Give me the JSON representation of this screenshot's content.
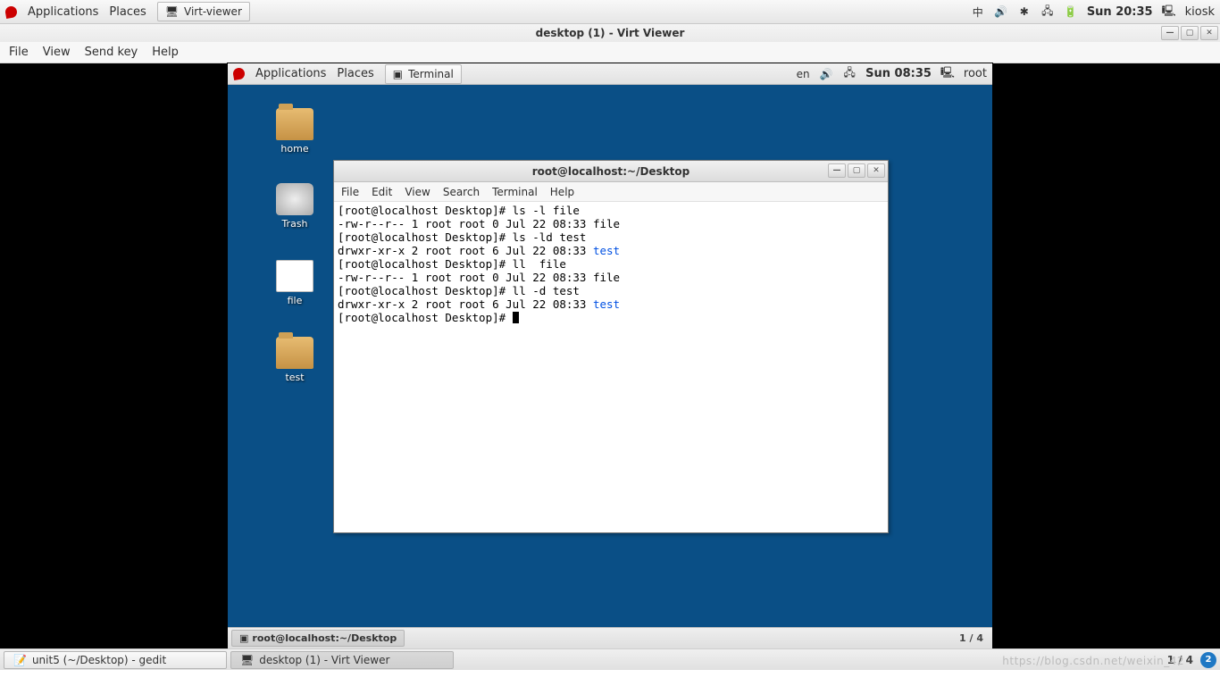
{
  "host": {
    "apps": "Applications",
    "places": "Places",
    "active_app": "Virt-viewer",
    "ime": "中",
    "time": "Sun 20:35",
    "user": "kiosk"
  },
  "vv": {
    "title": "desktop (1) - Virt Viewer",
    "menus": {
      "file": "File",
      "view": "View",
      "sendkey": "Send key",
      "help": "Help"
    }
  },
  "guest": {
    "topbar": {
      "apps": "Applications",
      "places": "Places",
      "active_app": "Terminal",
      "lang": "en",
      "time": "Sun 08:35",
      "user": "root"
    },
    "icons": {
      "home": "home",
      "trash": "Trash",
      "file": "file",
      "test": "test"
    },
    "taskbar": {
      "active": "root@localhost:~/Desktop",
      "pager": "1 / 4"
    }
  },
  "terminal": {
    "title": "root@localhost:~/Desktop",
    "menus": {
      "file": "File",
      "edit": "Edit",
      "view": "View",
      "search": "Search",
      "terminal": "Terminal",
      "help": "Help"
    },
    "lines": [
      {
        "prompt": "[root@localhost Desktop]# ",
        "cmd": "ls -l file"
      },
      {
        "out": "-rw-r--r-- 1 root root 0 Jul 22 08:33 file"
      },
      {
        "prompt": "[root@localhost Desktop]# ",
        "cmd": "ls -ld test"
      },
      {
        "out": "drwxr-xr-x 2 root root 6 Jul 22 08:33 ",
        "link": "test"
      },
      {
        "prompt": "[root@localhost Desktop]# ",
        "cmd": "ll  file"
      },
      {
        "out": "-rw-r--r-- 1 root root 0 Jul 22 08:33 file"
      },
      {
        "prompt": "[root@localhost Desktop]# ",
        "cmd": "ll -d test"
      },
      {
        "out": "drwxr-xr-x 2 root root 6 Jul 22 08:33 ",
        "link": "test"
      },
      {
        "prompt": "[root@localhost Desktop]# ",
        "cursor": true
      }
    ]
  },
  "host_taskbar": {
    "gedit": "unit5 (~/Desktop) - gedit",
    "vv": "desktop (1) - Virt Viewer",
    "pager": "1 / 4",
    "watermark": "https://blog.csdn.net/weixin_42"
  }
}
